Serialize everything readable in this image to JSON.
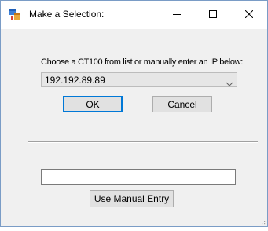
{
  "window": {
    "title": "Make a Selection:",
    "icon": "app-window-icon",
    "controls": [
      "minimize-icon",
      "maximize-icon",
      "close-icon"
    ]
  },
  "form": {
    "prompt": "Choose a CT100 from list or manually enter an IP below:",
    "combo_value": "192.192.89.89",
    "ok_label": "OK",
    "cancel_label": "Cancel",
    "manual_input_value": "",
    "manual_button_label": "Use Manual Entry"
  },
  "colors": {
    "dialog_bg": "#f0f0f0",
    "focus_accent": "#0078d7"
  }
}
